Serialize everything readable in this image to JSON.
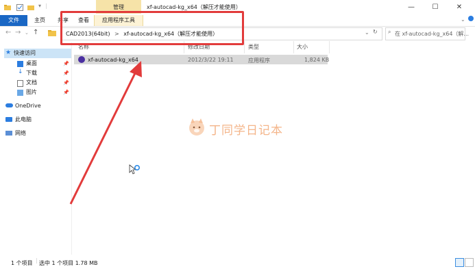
{
  "titlebar": {
    "manage_tab": "管理",
    "window_title": "xf-autocad-kg_x64（解压才能使用）",
    "minimize": "—",
    "maximize": "☐",
    "close": "✕"
  },
  "ribbon": {
    "tabs": [
      "文件",
      "主页",
      "共享",
      "查看",
      "应用程序工具"
    ]
  },
  "address": {
    "path_root": "CAD2013(64bit)",
    "separator": ">",
    "path_leaf": "xf-autocad-kg_x64（解压才能使用）",
    "search_placeholder": "在 xf-autocad-kg_x64（解..."
  },
  "sidebar": {
    "items": [
      {
        "label": "快速访问",
        "icon": "star-icon"
      },
      {
        "label": "桌面",
        "icon": "desktop-icon"
      },
      {
        "label": "下载",
        "icon": "download-icon"
      },
      {
        "label": "文档",
        "icon": "document-icon"
      },
      {
        "label": "图片",
        "icon": "picture-icon"
      },
      {
        "label": "OneDrive",
        "icon": "cloud-icon"
      },
      {
        "label": "此电脑",
        "icon": "computer-icon"
      },
      {
        "label": "网络",
        "icon": "network-icon"
      }
    ]
  },
  "columns": {
    "name": "名称",
    "modified": "修改日期",
    "type": "类型",
    "size": "大小"
  },
  "files": [
    {
      "name": "xf-autocad-kg_x64",
      "modified": "2012/3/22 19:11",
      "type": "应用程序",
      "size": "1,824 KB"
    }
  ],
  "status": {
    "count": "1 个项目",
    "selected": "选中 1 个项目  1.78 MB"
  },
  "watermark": {
    "text": "丁同学日记本"
  },
  "colors": {
    "accent": "#1a67c4",
    "manage_tab": "#f6e3a8",
    "annotation": "#e23b3b",
    "watermark": "#f4b58a"
  }
}
